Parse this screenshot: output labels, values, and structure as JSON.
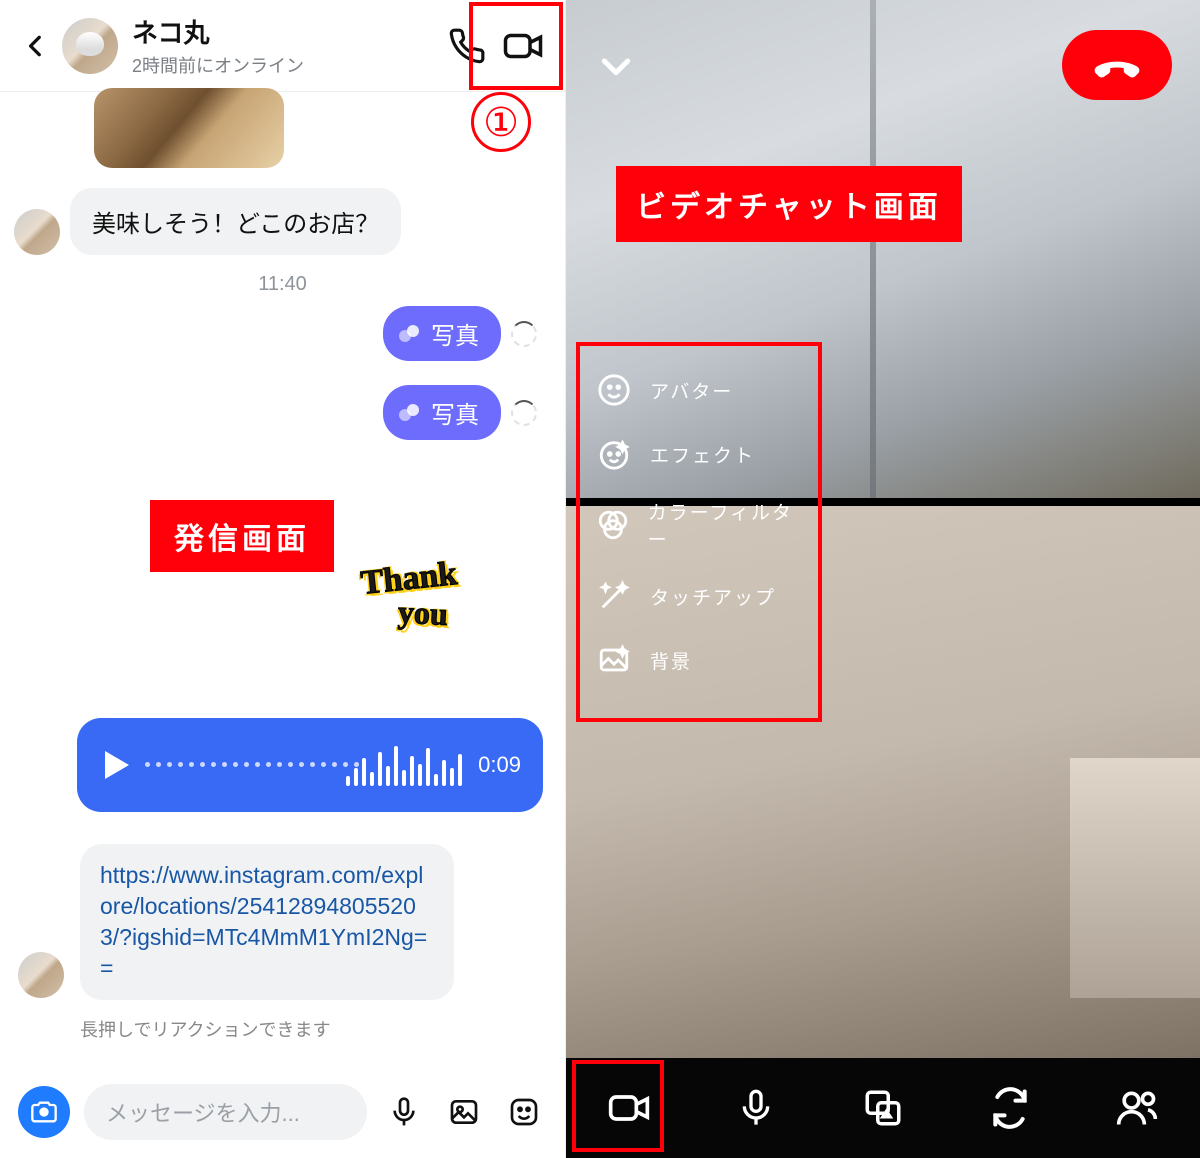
{
  "left": {
    "header": {
      "name": "ネコ丸",
      "status": "2時間前にオンライン"
    },
    "messages": {
      "incoming_text": "美味しそう！どこのお店？",
      "timestamp": "11:40",
      "chip1": "写真",
      "chip2": "写真",
      "thank1": "Thank",
      "thank2": "you",
      "voice_time": "0:09",
      "link_text": "https://www.instagram.com/explore/locations/254128948055203/?igshid=MTc4MmM1YmI2Ng==",
      "hint": "長押しでリアクションできます"
    },
    "input": {
      "placeholder": "メッセージを入力..."
    },
    "annotation": {
      "circle": "①",
      "label": "発信画面"
    }
  },
  "right": {
    "annotation": {
      "label": "ビデオチャット画面"
    },
    "effects": {
      "items": [
        {
          "label": "アバター"
        },
        {
          "label": "エフェクト"
        },
        {
          "label": "カラーフィルター"
        },
        {
          "label": "タッチアップ"
        },
        {
          "label": "背景"
        }
      ]
    }
  }
}
